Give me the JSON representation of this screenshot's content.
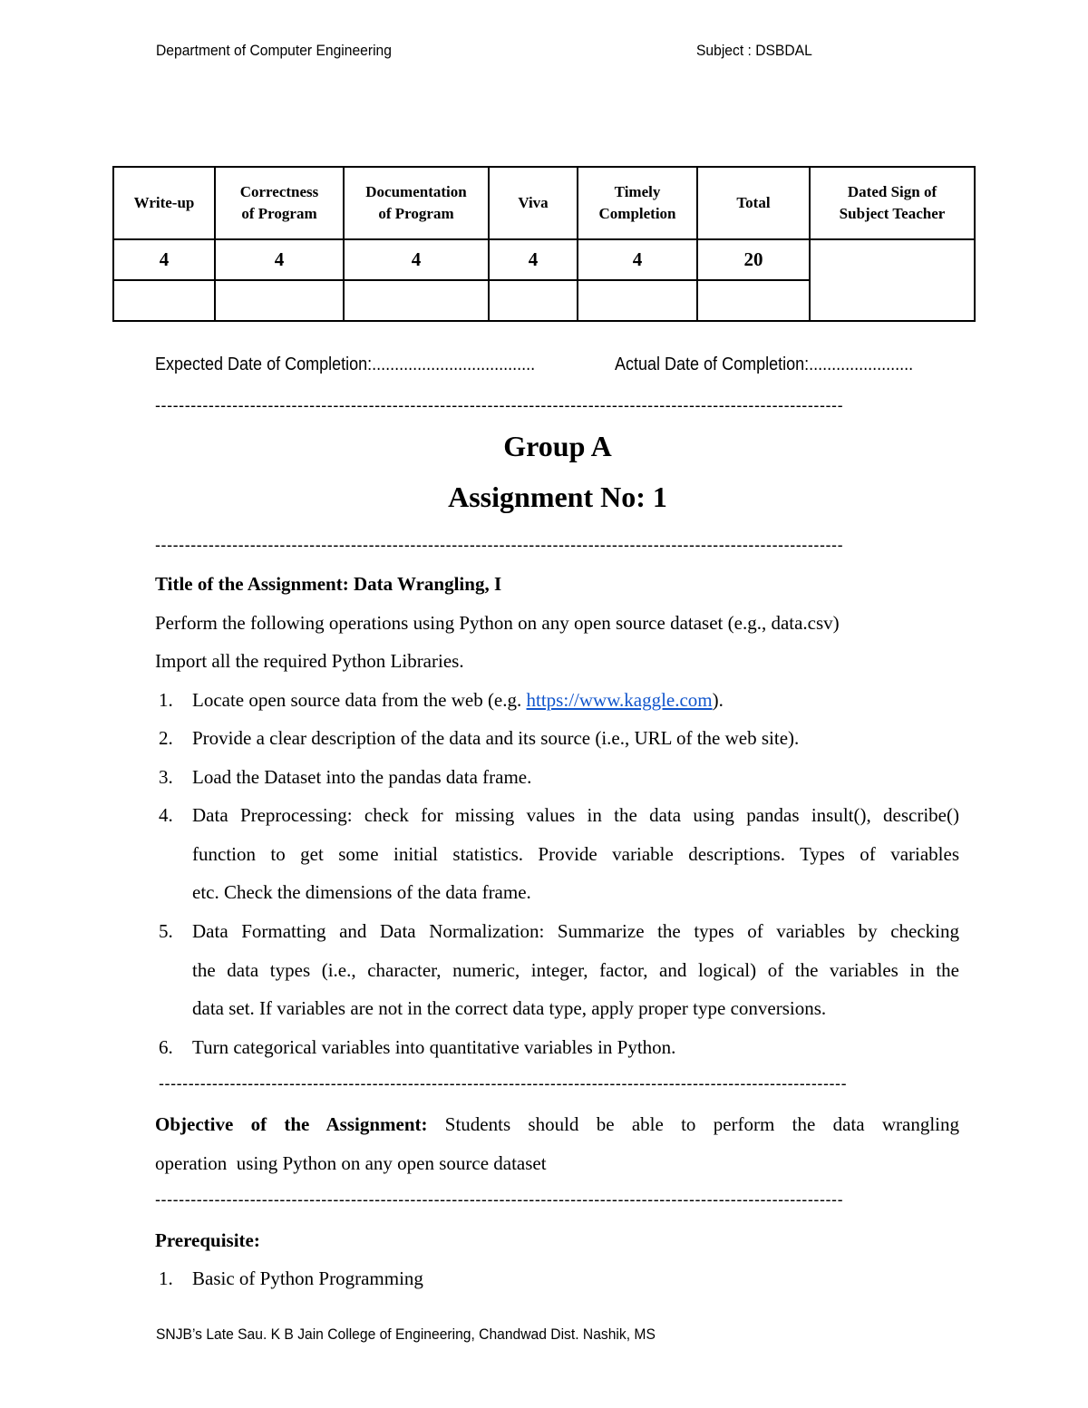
{
  "header": {
    "department": "Department of Computer Engineering",
    "subject": "Subject : DSBDAL"
  },
  "marks_table": {
    "headers": [
      "Write-up",
      "Correctness|of Program",
      "Documentation|of Program",
      "Viva",
      "Timely|Completion",
      "Total",
      "Dated Sign of|Subject Teacher"
    ],
    "header_lines": [
      [
        "Write-up"
      ],
      [
        "Correctness",
        "of Program"
      ],
      [
        "Documentation",
        "of Program"
      ],
      [
        "Viva"
      ],
      [
        "Timely",
        "Completion"
      ],
      [
        "Total"
      ],
      [
        "Dated Sign of",
        "Subject Teacher"
      ]
    ],
    "max_marks": [
      "4",
      "4",
      "4",
      "4",
      "4",
      "20"
    ],
    "obtained_marks": [
      "",
      "",
      "",
      "",
      "",
      ""
    ]
  },
  "dates": {
    "expected": "Expected Date of Completion:....................................",
    "actual": "Actual Date of Completion:......................."
  },
  "divider": "--------------------------------------------------------------------------------------------------------------------",
  "group": "Group A",
  "assignment_no": "Assignment No: 1",
  "title": {
    "label": "Title of the Assignment: Data Wrangling, I"
  },
  "intro": [
    "Perform the following operations using Python on any open source dataset (e.g., data.csv)",
    "Import all the required Python Libraries."
  ],
  "tasks": [
    {
      "num": "1.",
      "pre": "Locate open source data from the web (e.g. ",
      "link": "https://www.kaggle.com",
      "post": ")."
    },
    {
      "num": "2.",
      "text": "Provide a clear description of the data and its source (i.e., URL of the web site)."
    },
    {
      "num": "3.",
      "text": "Load the Dataset into the pandas data frame."
    },
    {
      "num": "4.",
      "lines": [
        "Data Preprocessing: check for missing values in the data using pandas insult(), describe()",
        "function to get some initial statistics. Provide variable descriptions. Types of variables",
        "etc. Check the dimensions of the data frame."
      ]
    },
    {
      "num": "5.",
      "lines": [
        "Data Formatting and Data Normalization: Summarize the types of variables by checking",
        "the data types (i.e., character, numeric, integer, factor, and logical) of the variables in the",
        "data set. If variables are not in the correct data type, apply proper type conversions."
      ]
    },
    {
      "num": "6.",
      "text": "Turn categorical variables into quantitative variables in Python."
    }
  ],
  "objective": {
    "label": "Objective of the Assignment:",
    "line1": "Students should be able to perform the data wrangling",
    "line2": "operation  using Python on any open source dataset"
  },
  "prerequisite": {
    "label": "Prerequisite:",
    "items": [
      {
        "num": "1.",
        "text": "Basic of Python Programming"
      }
    ]
  },
  "footer": "SNJB’s Late Sau. K B Jain College of Engineering, Chandwad Dist. Nashik, MS"
}
